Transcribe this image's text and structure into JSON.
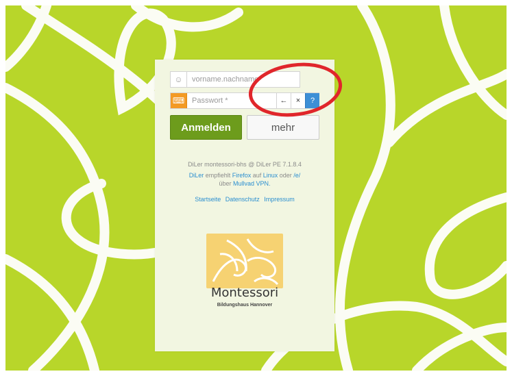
{
  "login": {
    "username_placeholder": "vorname.nachname",
    "password_placeholder": "Passwort *",
    "back_glyph": "←",
    "clear_glyph": "×",
    "help_glyph": "?",
    "login_button": "Anmelden",
    "more_button": "mehr"
  },
  "info": {
    "version_line": "DiLer montessori-bhs @ DiLer PE 7.1.8.4",
    "recommend": {
      "brand": "DiLer",
      "text1": " empfiehlt ",
      "firefox": "Firefox",
      "text2": " auf ",
      "linux": "Linux",
      "text3": " oder ",
      "e": "/e/",
      "text4": "über ",
      "vpn": "Mullvad VPN."
    },
    "links": [
      "Startseite",
      "Datenschutz",
      "Impressum"
    ]
  },
  "logo": {
    "name": "Montessori",
    "subtitle": "Bildungshaus Hannover"
  },
  "colors": {
    "background_green": "#b8d62a",
    "card": "#f2f6e1",
    "primary_button": "#6d9c1c",
    "link": "#2a8ed0",
    "highlight_circle": "#e0262b"
  },
  "icons": {
    "username": "user-icon",
    "password": "keyboard-icon"
  }
}
